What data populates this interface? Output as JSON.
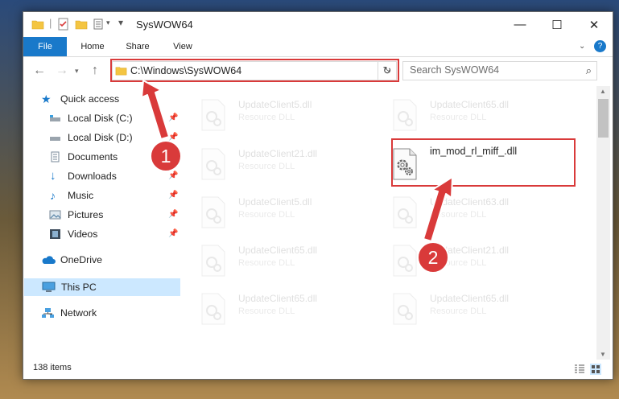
{
  "window": {
    "title": "SysWOW64",
    "controls": {
      "minimize": "—",
      "maximize": "☐",
      "close": "✕"
    }
  },
  "ribbon": {
    "tabs": [
      {
        "label": "File"
      },
      {
        "label": "Home"
      },
      {
        "label": "Share"
      },
      {
        "label": "View"
      }
    ],
    "help": "?"
  },
  "nav": {
    "address": "C:\\Windows\\SysWOW64",
    "search_placeholder": "Search SysWOW64"
  },
  "sidebar": {
    "items": [
      {
        "label": "Quick access",
        "icon": "star-icon"
      },
      {
        "label": "Local Disk (C:)",
        "icon": "drive-icon",
        "pinned": true
      },
      {
        "label": "Local Disk (D:)",
        "icon": "drive-icon",
        "pinned": true
      },
      {
        "label": "Documents",
        "icon": "documents-icon",
        "pinned": true
      },
      {
        "label": "Downloads",
        "icon": "download-icon",
        "pinned": true
      },
      {
        "label": "Music",
        "icon": "music-icon",
        "pinned": true
      },
      {
        "label": "Pictures",
        "icon": "pictures-icon",
        "pinned": true
      },
      {
        "label": "Videos",
        "icon": "videos-icon",
        "pinned": true
      },
      {
        "label": "OneDrive",
        "icon": "cloud-icon"
      },
      {
        "label": "This PC",
        "icon": "computer-icon",
        "selected": true
      },
      {
        "label": "Network",
        "icon": "network-icon"
      }
    ]
  },
  "files": [
    {
      "name": "UpdateClient5.dll",
      "type": "Resource DLL"
    },
    {
      "name": "UpdateClient65.dll",
      "type": "Resource DLL"
    },
    {
      "name": "UpdateClient21.dll",
      "type": "Resource DLL"
    },
    {
      "name": "im_mod_rl_miff_.dll",
      "type": ""
    },
    {
      "name": "UpdateClient5.dll",
      "type": "Resource DLL"
    },
    {
      "name": "UpdateClient63.dll",
      "type": "Resource DLL"
    },
    {
      "name": "UpdateClient65.dll",
      "type": "Resource DLL"
    },
    {
      "name": "UpdateClient21.dll",
      "type": "Resource DLL"
    },
    {
      "name": "UpdateClient65.dll",
      "type": "Resource DLL"
    },
    {
      "name": "UpdateClient65.dll",
      "type": "Resource DLL"
    }
  ],
  "status": {
    "count": "138 items"
  },
  "annotations": {
    "badge1": "1",
    "badge2": "2",
    "color": "#d93a3a"
  }
}
